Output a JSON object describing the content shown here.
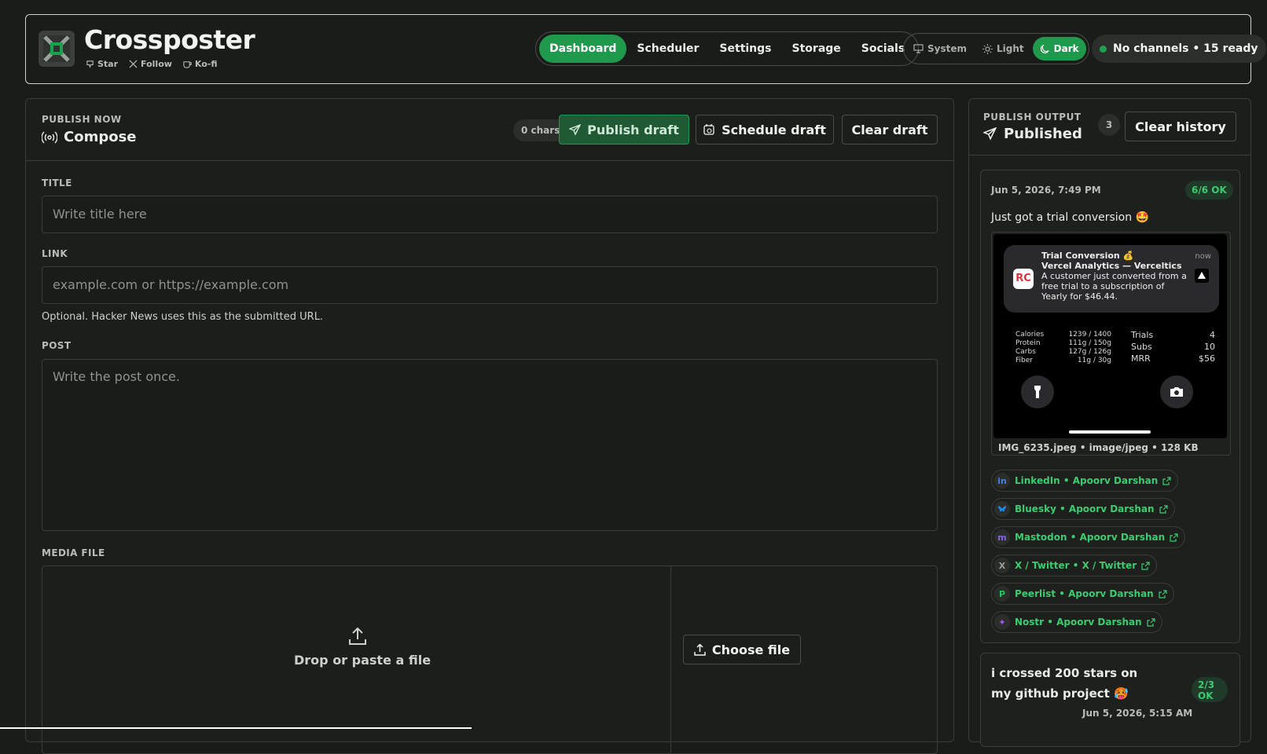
{
  "app": {
    "name": "Crossposter",
    "links": [
      {
        "label": "Star",
        "icon": "github-icon"
      },
      {
        "label": "Follow",
        "icon": "x-icon"
      },
      {
        "label": "Ko-fi",
        "icon": "coffee-icon"
      }
    ]
  },
  "nav": {
    "tabs": [
      "Dashboard",
      "Scheduler",
      "Settings",
      "Storage",
      "Socials"
    ],
    "active": "Dashboard"
  },
  "theme": {
    "options": [
      "System",
      "Light",
      "Dark"
    ],
    "active": "Dark"
  },
  "status": {
    "text": "No channels • 15 ready",
    "color": "#1fa050"
  },
  "compose": {
    "overline": "PUBLISH NOW",
    "title": "Compose",
    "chars": "0 chars",
    "publish_label": "Publish draft",
    "schedule_label": "Schedule draft",
    "clear_label": "Clear draft",
    "title_label": "TITLE",
    "title_placeholder": "Write title here",
    "link_label": "LINK",
    "link_placeholder": "example.com or https://example.com",
    "link_help": "Optional. Hacker News uses this as the submitted URL.",
    "post_label": "POST",
    "post_placeholder": "Write the post once.",
    "media_label": "MEDIA FILE",
    "drop_text": "Drop or paste a file",
    "choose_label": "Choose file"
  },
  "output": {
    "overline": "PUBLISH OUTPUT",
    "title": "Published",
    "count": "3",
    "clear_label": "Clear history",
    "entries": [
      {
        "date": "Jun 5, 2026, 7:49 PM",
        "badge": "6/6 OK",
        "text": "Just got a trial conversion 🤩",
        "file_meta": "IMG_6235.jpeg • image/jpeg • 128 KB",
        "screenshot": {
          "notif_title": "Trial Conversion 💰",
          "notif_app": "Vercel Analytics — Verceltics",
          "notif_body": "A customer just converted from a free trial to a subscription of Yearly for $46.44.",
          "notif_time": "now",
          "nutrition": [
            {
              "label": "Calories",
              "value": "1239 / 1400"
            },
            {
              "label": "Protein",
              "value": "111g / 150g"
            },
            {
              "label": "Carbs",
              "value": "127g / 126g"
            },
            {
              "label": "Fiber",
              "value": "11g / 30g"
            }
          ],
          "stats": [
            {
              "label": "Trials",
              "value": "4"
            },
            {
              "label": "Subs",
              "value": "10"
            },
            {
              "label": "MRR",
              "value": "$56"
            }
          ]
        },
        "links": [
          {
            "label": "LinkedIn • Apoorv Darshan",
            "icon": "in",
            "color": "#3b82f6"
          },
          {
            "label": "Bluesky • Apoorv Darshan",
            "icon": "🦋",
            "color": "#1d8cf8"
          },
          {
            "label": "Mastodon • Apoorv Darshan",
            "icon": "m",
            "color": "#8b5cf6"
          },
          {
            "label": "X / Twitter • X / Twitter",
            "icon": "X",
            "color": "#9aa09a"
          },
          {
            "label": "Peerlist • Apoorv Darshan",
            "icon": "P",
            "color": "#22c55e"
          },
          {
            "label": "Nostr • Apoorv Darshan",
            "icon": "✦",
            "color": "#a855f7"
          }
        ]
      },
      {
        "text": "i crossed 200 stars on my github project 🥵",
        "date": "Jun 5, 2026, 5:15 AM",
        "badge": "2/3 OK"
      }
    ]
  }
}
